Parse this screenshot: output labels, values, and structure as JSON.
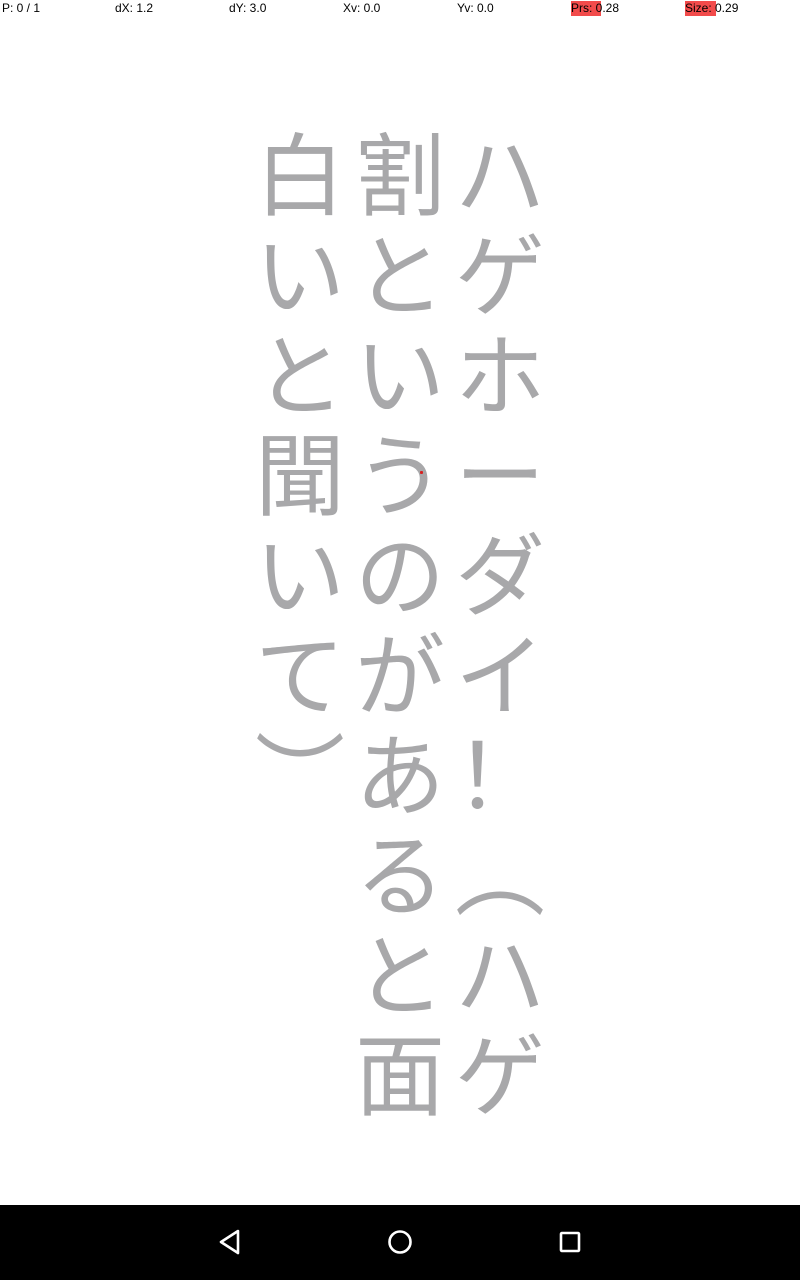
{
  "status_bar": {
    "pointer": "P: 0 / 1",
    "dx": "dX: 1.2",
    "dy": "dY: 3.0",
    "xv": "Xv: 0.0",
    "yv": "Yv: 0.0",
    "prs": "Prs: 0.28",
    "size": "Size: 0.29",
    "highlight_color": "#f24b4b"
  },
  "handwriting": {
    "text_color": "#a8a8aa",
    "columns": [
      {
        "text": "ハゲホーダイ！︵ハゲ",
        "glyphs": [
          "ハ",
          "ゲ",
          "ホ",
          "ー",
          "ダ",
          "イ",
          "！",
          "︵",
          "ハ",
          "ゲ"
        ]
      },
      {
        "text": "割というのがあると面",
        "glyphs": [
          "割",
          "と",
          "い",
          "う",
          "の",
          "が",
          "あ",
          "る",
          "と",
          "面"
        ]
      },
      {
        "text": "白いと聞いて︶",
        "glyphs": [
          "白",
          "い",
          "と",
          "聞",
          "い",
          "て",
          "︶"
        ]
      }
    ],
    "touch_point_color": "#d62020"
  },
  "nav_bar": {
    "back_icon": "back-triangle-icon",
    "home_icon": "home-circle-icon",
    "recents_icon": "recents-square-icon"
  }
}
